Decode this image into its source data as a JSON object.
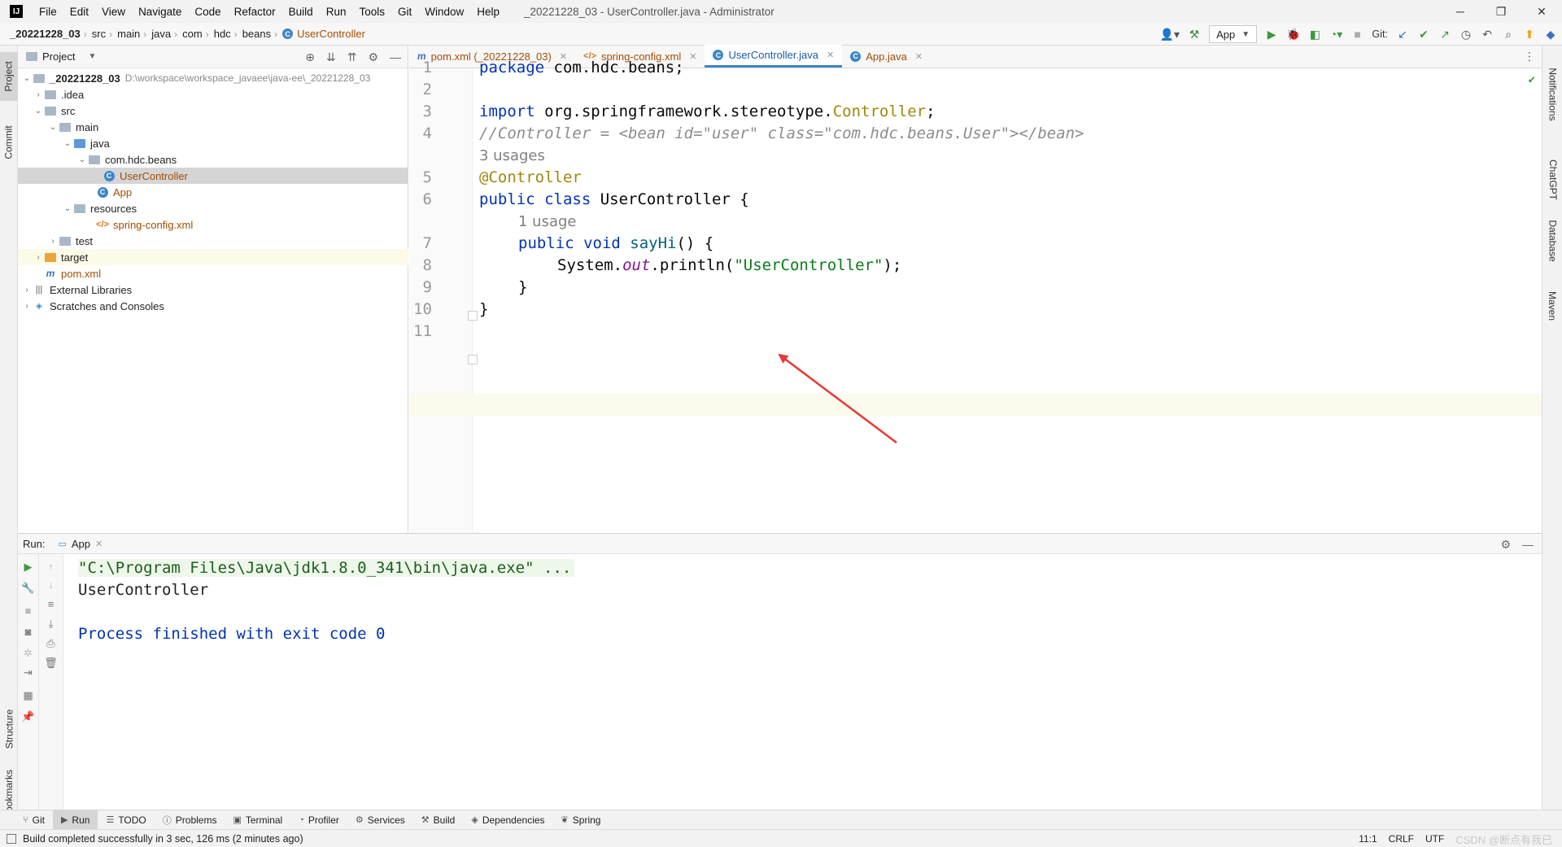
{
  "window": {
    "title": "_20221228_03 - UserController.java - Administrator",
    "logo": "IJ",
    "controls": [
      "─",
      "❐",
      "✕"
    ]
  },
  "menu": [
    "File",
    "Edit",
    "View",
    "Navigate",
    "Code",
    "Refactor",
    "Build",
    "Run",
    "Tools",
    "Git",
    "Window",
    "Help"
  ],
  "breadcrumb": [
    "_20221228_03",
    "src",
    "main",
    "java",
    "com",
    "hdc",
    "beans",
    "UserController"
  ],
  "toolbar": {
    "run_config": "App",
    "git_label": "Git:"
  },
  "left_strip": {
    "project_tab": "Project",
    "commit_tab": "Commit",
    "structure_tab": "Structure",
    "bookmarks_tab": "Bookmarks"
  },
  "right_strip": {
    "notifications_tab": "Notifications",
    "chatgpt_tab": "ChatGPT",
    "database_tab": "Database",
    "maven_tab": "Maven"
  },
  "project_panel": {
    "title": "Project",
    "root": {
      "name": "_20221228_03",
      "path": "D:\\workspace\\workspace_javaee\\java-ee\\_20221228_03"
    },
    "tree": [
      {
        "label": ".idea"
      },
      {
        "label": "src"
      },
      {
        "label": "main"
      },
      {
        "label": "java"
      },
      {
        "label": "com.hdc.beans"
      },
      {
        "label": "UserController"
      },
      {
        "label": "App"
      },
      {
        "label": "resources"
      },
      {
        "label": "spring-config.xml"
      },
      {
        "label": "test"
      },
      {
        "label": "target"
      },
      {
        "label": "pom.xml"
      },
      {
        "label": "External Libraries"
      },
      {
        "label": "Scratches and Consoles"
      }
    ]
  },
  "editor_tabs": [
    {
      "label": "pom.xml (_20221228_03)",
      "active": false
    },
    {
      "label": "spring-config.xml",
      "active": false
    },
    {
      "label": "UserController.java",
      "active": true
    },
    {
      "label": "App.java",
      "active": false
    }
  ],
  "editor": {
    "line_numbers": [
      "1",
      "2",
      "3",
      "4",
      "5",
      "6",
      "7",
      "8",
      "9",
      "10",
      "11"
    ],
    "code": {
      "l1_kw": "package",
      "l1_rest": " com.hdc.beans;",
      "l3_kw": "import",
      "l3_mid": " org.springframework.stereotype.",
      "l3_cls": "Controller",
      "l3_end": ";",
      "l4_comment": "//Controller = <bean id=\"user\" class=\"com.hdc.beans.User\"></bean>",
      "usages_class": "3 usages",
      "l5_ann": "@Controller",
      "l6_kw": "public class",
      "l6_rest": " UserController {",
      "usages_method": "1 usage",
      "l7_kw": "public void",
      "l7_fn": " sayHi",
      "l7_rest": "() {",
      "l8_a": "System.",
      "l8_fld": "out",
      "l8_b": ".println(",
      "l8_str": "\"UserController\"",
      "l8_c": ");",
      "l9": "}",
      "l10": "}"
    }
  },
  "run_panel": {
    "label": "Run:",
    "tab": "App",
    "console": {
      "command": "\"C:\\Program Files\\Java\\jdk1.8.0_341\\bin\\java.exe\" ...",
      "output": "UserController",
      "finished": "Process finished with exit code 0"
    }
  },
  "toolwindow_bar": [
    "Git",
    "Run",
    "TODO",
    "Problems",
    "Terminal",
    "Profiler",
    "Services",
    "Build",
    "Dependencies",
    "Spring"
  ],
  "statusbar": {
    "message": "Build completed successfully in 3 sec, 126 ms (2 minutes ago)",
    "position": "11:1",
    "line_sep": "CRLF",
    "encoding": "UTF",
    "watermark": "CSDN @断点有我已"
  },
  "colors": {
    "keyword": "#0033b3",
    "annotation": "#9e880d",
    "string": "#067d17",
    "comment": "#8c8c8c",
    "arrow": "#e53935",
    "active_tab": "#4083c9"
  }
}
